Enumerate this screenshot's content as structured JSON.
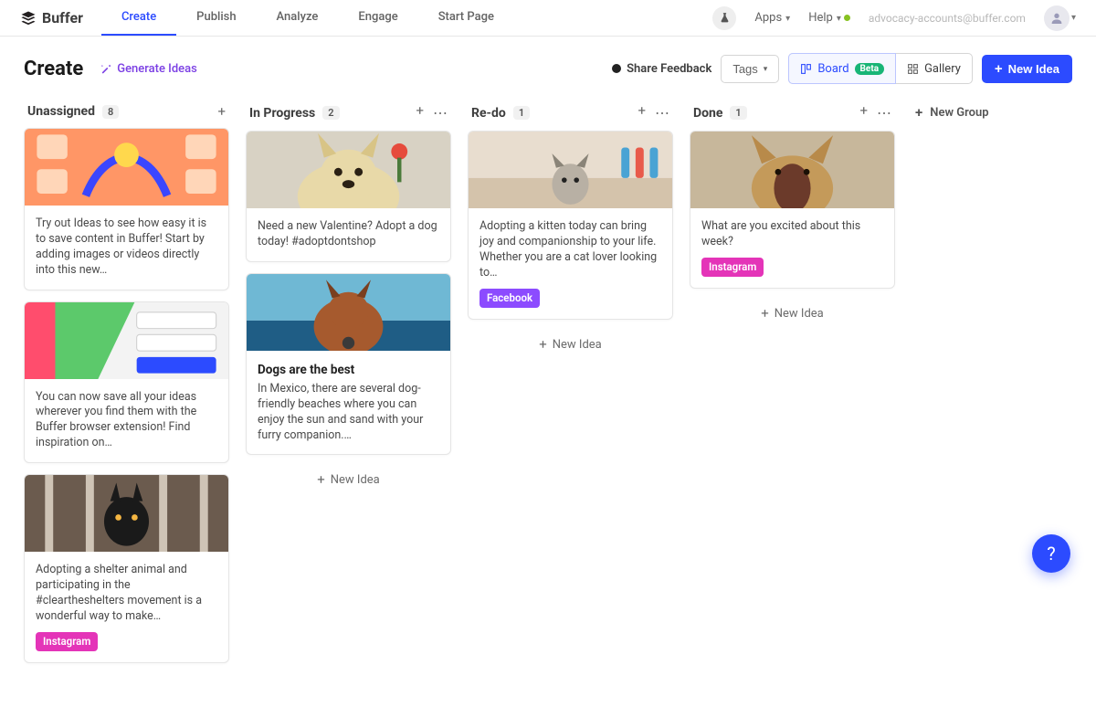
{
  "nav": {
    "brand": "Buffer",
    "tabs": [
      "Create",
      "Publish",
      "Analyze",
      "Engage",
      "Start Page"
    ],
    "active_tab_index": 0,
    "apps": "Apps",
    "help": "Help",
    "user_email": "advocacy-accounts@buffer.com"
  },
  "header": {
    "title": "Create",
    "generate_ideas": "Generate Ideas",
    "share_feedback": "Share Feedback",
    "tags_label": "Tags",
    "board_label": "Board",
    "board_badge": "Beta",
    "gallery_label": "Gallery",
    "new_idea": "New Idea"
  },
  "board": {
    "new_group": "New Group",
    "new_idea_row": "New Idea",
    "columns": [
      {
        "title": "Unassigned",
        "count": "8",
        "show_more": false,
        "cards": [
          {
            "text": "Try out Ideas to see how easy it is to save content in Buffer! Start by adding images or videos directly into this new…",
            "thumb": "illo1",
            "tag": null
          },
          {
            "text": "You can now save all your ideas wherever you find them with the Buffer browser extension! Find inspiration on…",
            "thumb": "illo2",
            "tag": null
          },
          {
            "text": "Adopting a shelter animal and participating in the #cleartheshelters movement is a wonderful way to make…",
            "thumb": "cat_bars",
            "tag": "Instagram"
          }
        ]
      },
      {
        "title": "In Progress",
        "count": "2",
        "show_more": true,
        "cards": [
          {
            "text": "Need a new Valentine? Adopt a dog today! #adoptdontshop",
            "thumb": "dog_flower",
            "tag": null
          },
          {
            "title": "Dogs are the best",
            "text": "In Mexico, there are several dog-friendly beaches where you can enjoy the sun and sand with your furry companion.…",
            "thumb": "dog_sea",
            "tag": null
          }
        ]
      },
      {
        "title": "Re-do",
        "count": "1",
        "show_more": true,
        "cards": [
          {
            "text": "Adopting a kitten today can bring joy and companionship to your life. Whether you are a cat lover looking to…",
            "thumb": "kitten_bed",
            "tag": "Facebook"
          }
        ]
      },
      {
        "title": "Done",
        "count": "1",
        "show_more": true,
        "cards": [
          {
            "text": "What are you excited about this week?",
            "thumb": "cat_yawn",
            "tag": "Instagram"
          }
        ]
      }
    ]
  }
}
